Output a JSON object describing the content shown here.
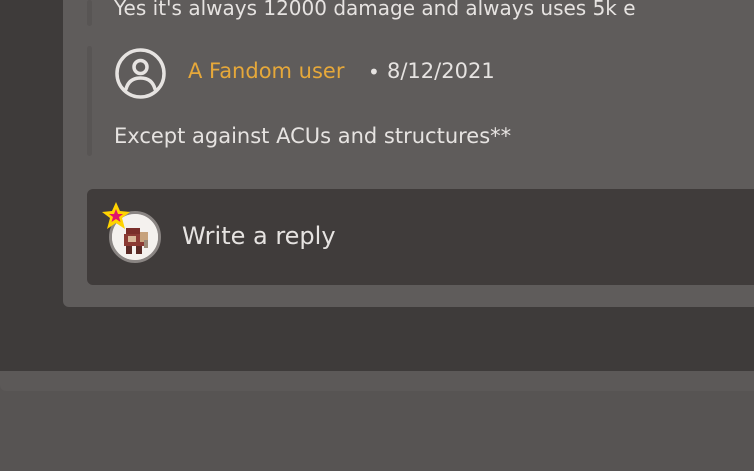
{
  "thread": {
    "previous_reply_truncated": "Yes it's always 12000 damage and always uses 5k e",
    "reply": {
      "author": "A Fandom user",
      "separator": "•",
      "date": "8/12/2021",
      "body": "Except against ACUs and structures**"
    }
  },
  "composer": {
    "placeholder": "Write a reply"
  },
  "colors": {
    "page_background": "#3e3b3a",
    "card_background": "#5f5c5b",
    "composer_background": "#403c3b",
    "username_accent": "#e6a83a",
    "text": "#e6e3e1",
    "star_badge": "#ffd400",
    "star_inner": "#e0156b"
  },
  "icons": {
    "user_avatar": "user-circle-icon",
    "badge": "star-badge-icon"
  }
}
